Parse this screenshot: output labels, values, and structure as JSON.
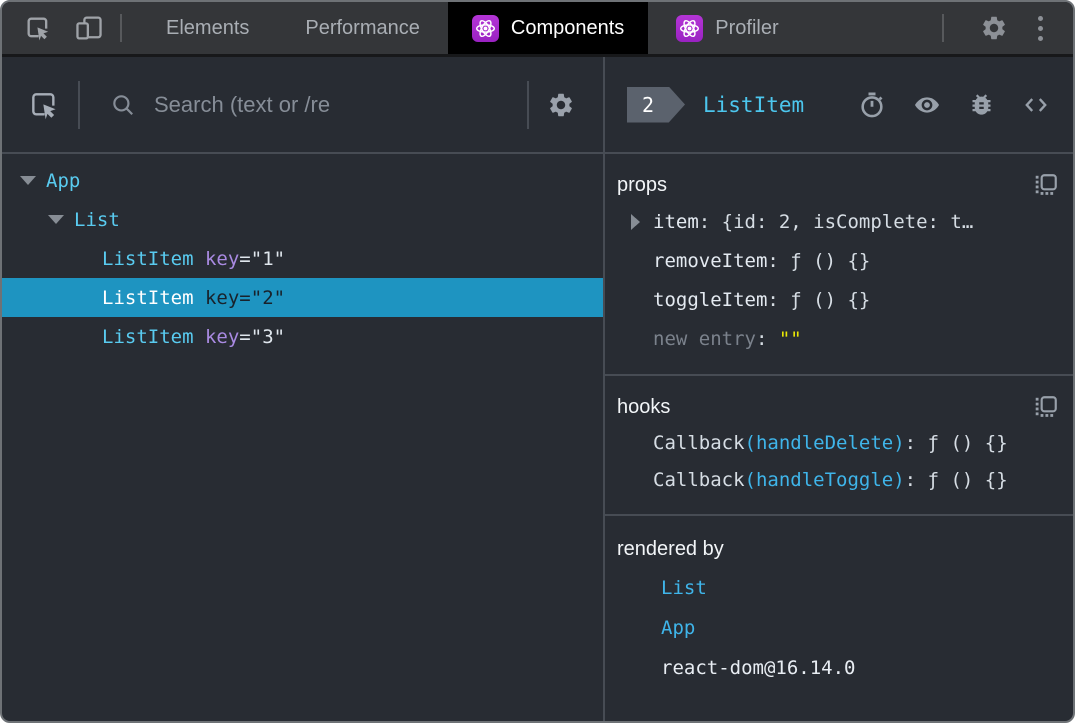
{
  "colors": {
    "selection_background": "#1e94c1",
    "component_name_cyan": "#59cbf0",
    "key_purple": "#a98ae2",
    "string_yellow": "#e9e706",
    "react_logo_purple": "#a82acd",
    "active_tab_background": "#000000"
  },
  "topbar": {
    "tabs": [
      {
        "label": "Elements",
        "active": false,
        "has_react_icon": false
      },
      {
        "label": "Performance",
        "active": false,
        "has_react_icon": false
      },
      {
        "label": "Components",
        "active": true,
        "has_react_icon": true
      },
      {
        "label": "Profiler",
        "active": false,
        "has_react_icon": true
      }
    ]
  },
  "left_panel": {
    "search": {
      "placeholder": "Search (text or /re"
    },
    "tree": [
      {
        "name": "App",
        "depth": 0,
        "expandable": true,
        "selected": false
      },
      {
        "name": "List",
        "depth": 1,
        "expandable": true,
        "selected": false
      },
      {
        "name": "ListItem",
        "depth": 2,
        "expandable": false,
        "selected": false,
        "attr_name": "key",
        "attr_eq": "=",
        "attr_value": "\"1\""
      },
      {
        "name": "ListItem",
        "depth": 2,
        "expandable": false,
        "selected": true,
        "attr_name": "key",
        "attr_eq": "=",
        "attr_value": "\"2\""
      },
      {
        "name": "ListItem",
        "depth": 2,
        "expandable": false,
        "selected": false,
        "attr_name": "key",
        "attr_eq": "=",
        "attr_value": "\"3\""
      }
    ]
  },
  "right_panel": {
    "header": {
      "badge": "2",
      "title": "ListItem"
    },
    "props": {
      "title": "props",
      "rows": [
        {
          "expandable": true,
          "name": "item",
          "sep": ": ",
          "value": "{id: 2, isComplete: t…",
          "muted": false,
          "value_style": "plain"
        },
        {
          "expandable": false,
          "name": "removeItem",
          "sep": ": ",
          "value": "ƒ () {}",
          "muted": false,
          "value_style": "plain"
        },
        {
          "expandable": false,
          "name": "toggleItem",
          "sep": ": ",
          "value": "ƒ () {}",
          "muted": false,
          "value_style": "plain"
        },
        {
          "expandable": false,
          "name": "new entry",
          "sep": ": ",
          "value": "\"\"",
          "muted": true,
          "value_style": "string"
        }
      ]
    },
    "hooks": {
      "title": "hooks",
      "rows": [
        {
          "fn": "Callback",
          "arg": "(handleDelete)",
          "sep": ": ",
          "value": "ƒ () {}"
        },
        {
          "fn": "Callback",
          "arg": "(handleToggle)",
          "sep": ": ",
          "value": "ƒ () {}"
        }
      ]
    },
    "rendered_by": {
      "title": "rendered by",
      "rows": [
        {
          "label": "List",
          "link": true
        },
        {
          "label": "App",
          "link": true
        },
        {
          "label": "react-dom@16.14.0",
          "link": false
        }
      ]
    }
  }
}
